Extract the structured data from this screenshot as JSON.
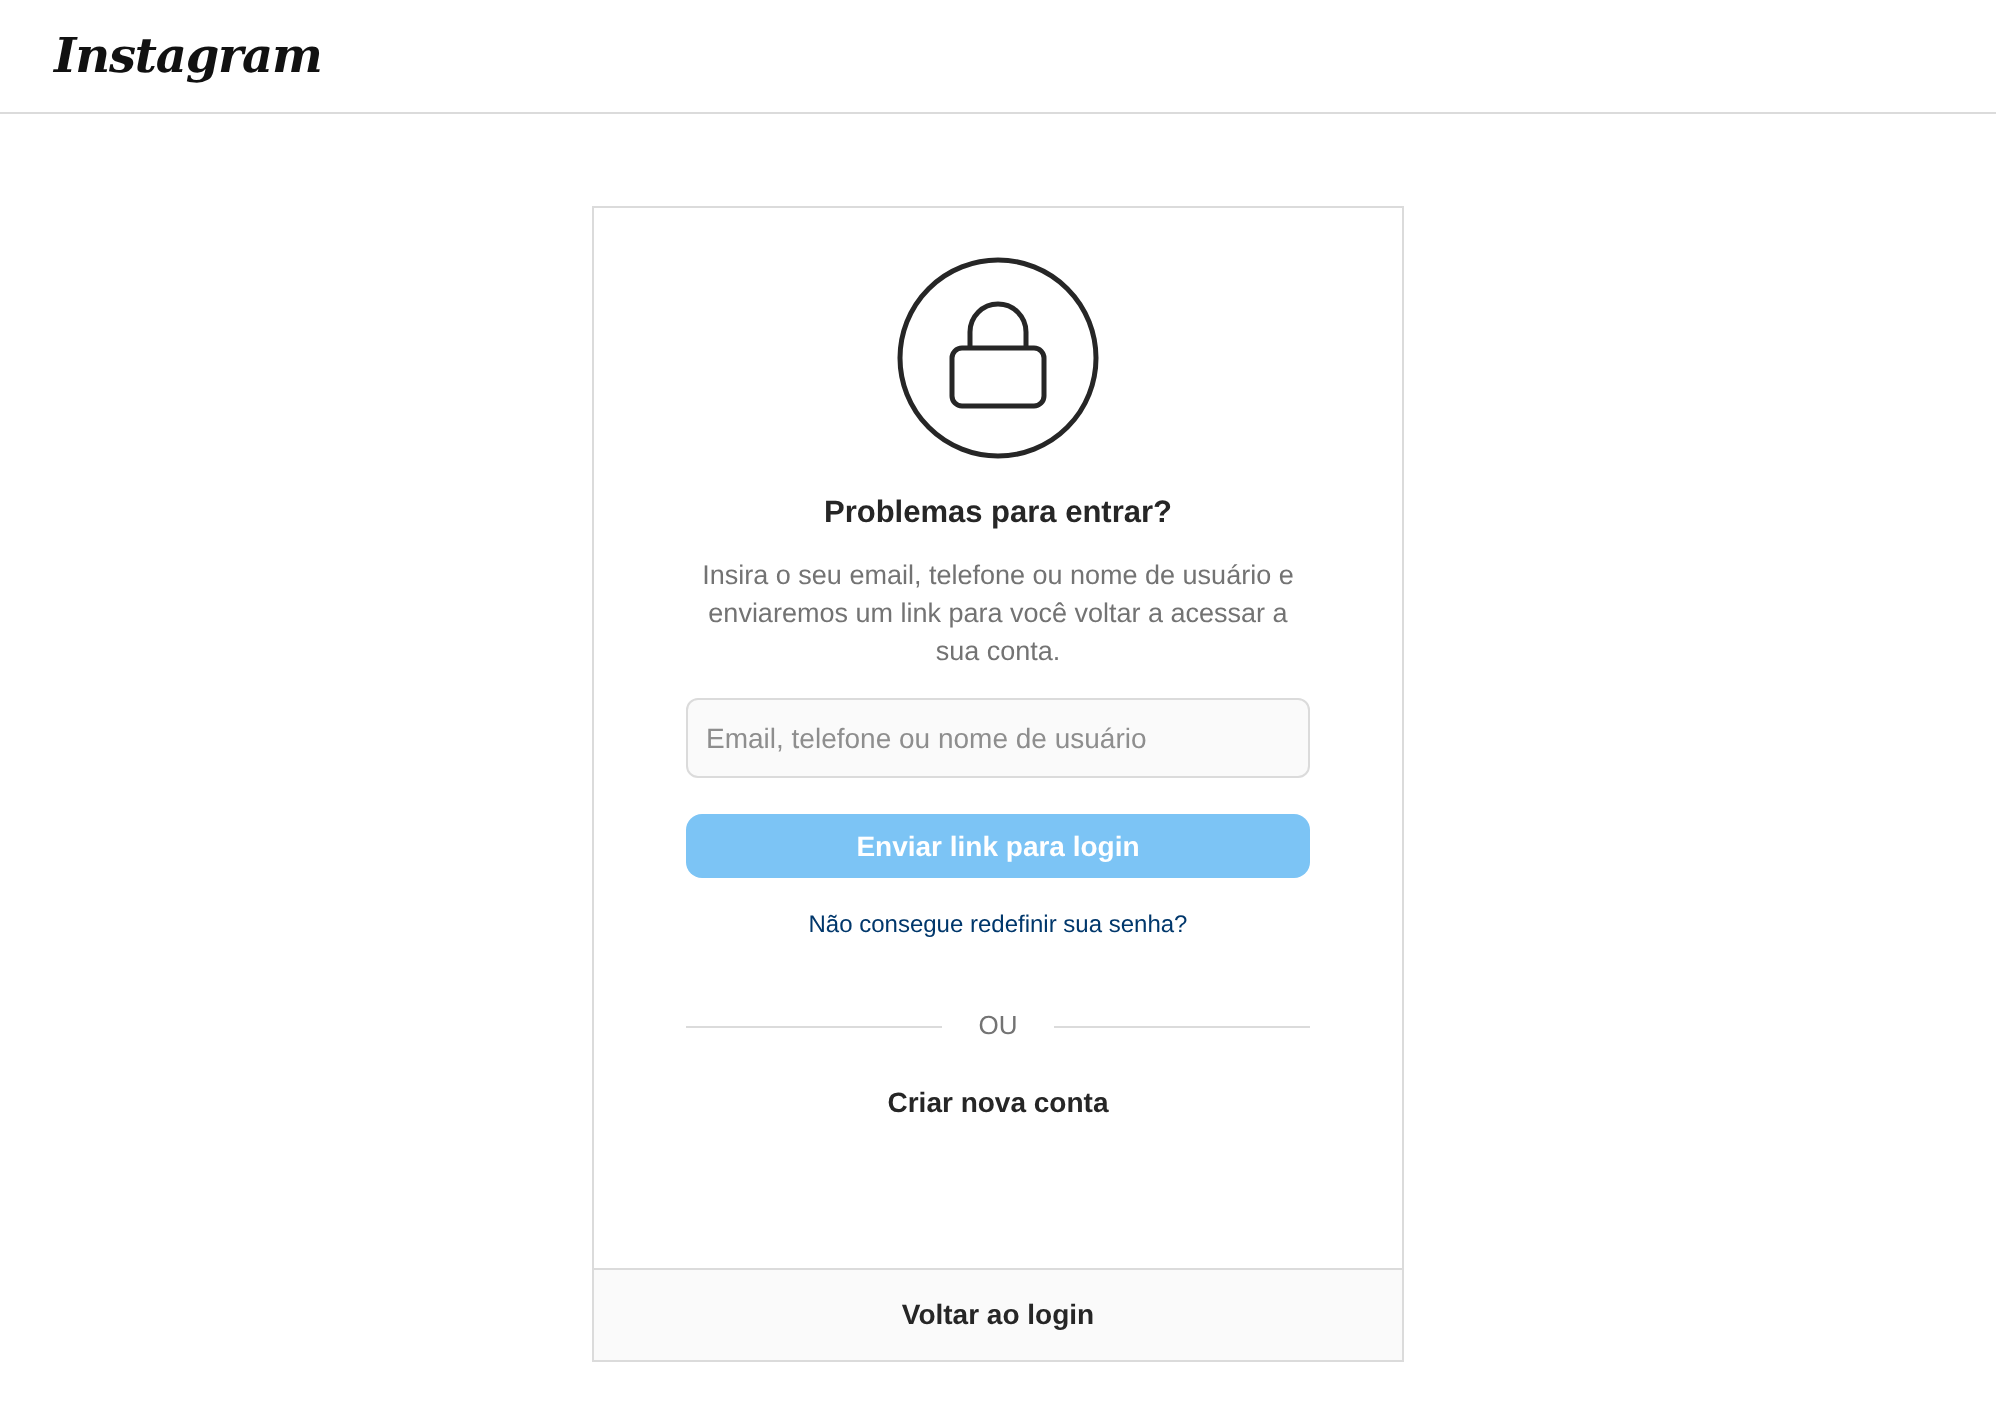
{
  "header": {
    "logo": "Instagram"
  },
  "card": {
    "title": "Problemas para entrar?",
    "description": "Insira o seu email, telefone ou nome de usuário e enviaremos um link para você voltar a acessar a sua conta.",
    "field": {
      "placeholder": "Email, telefone ou nome de usuário"
    },
    "submit": {
      "label": "Enviar link para login",
      "disabled": true
    },
    "help_link": "Não consegue redefinir sua senha?",
    "divider": "OU",
    "create_account": "Criar nova conta",
    "footer_link": "Voltar ao login"
  }
}
